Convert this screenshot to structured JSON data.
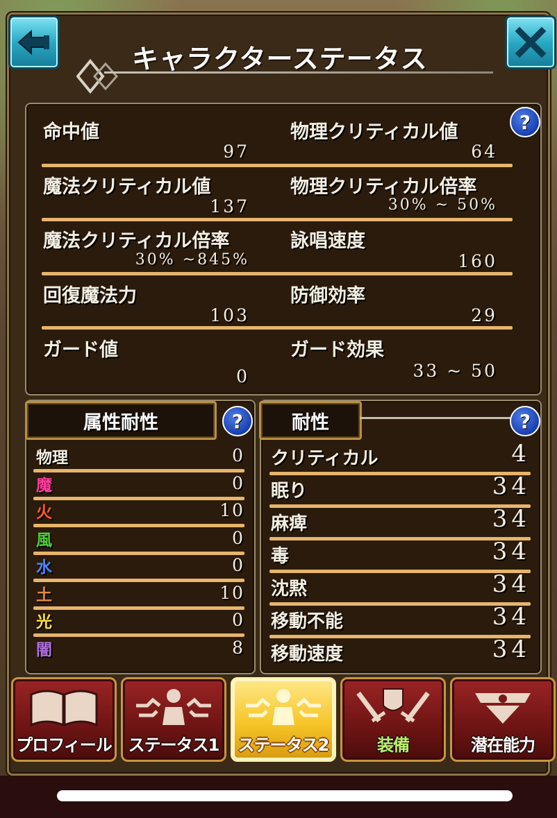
{
  "header": {
    "title": "キャラクターステータス"
  },
  "stats": {
    "rows": [
      {
        "left_label": "命中値",
        "left_value": "97",
        "right_label": "物理クリティカル値",
        "right_value": "64"
      },
      {
        "left_label": "魔法クリティカル値",
        "left_value": "137",
        "right_label": "物理クリティカル倍率",
        "right_value": "30% ~ 50%"
      },
      {
        "left_label": "魔法クリティカル倍率",
        "left_value": "30% ~845%",
        "right_label": "詠唱速度",
        "right_value": "160"
      },
      {
        "left_label": "回復魔法力",
        "left_value": "103",
        "right_label": "防御効率",
        "right_value": "29"
      },
      {
        "left_label": "ガード値",
        "left_value": "0",
        "right_label": "ガード効果",
        "right_value": "33 ~ 50"
      }
    ]
  },
  "element_resist": {
    "header": "属性耐性",
    "items": [
      {
        "label": "物理",
        "value": "0",
        "color": "#f4eee2"
      },
      {
        "label": "魔",
        "value": "0",
        "color": "#ff3fa0"
      },
      {
        "label": "火",
        "value": "10",
        "color": "#ff5a2a"
      },
      {
        "label": "風",
        "value": "0",
        "color": "#4fcf3a"
      },
      {
        "label": "水",
        "value": "0",
        "color": "#4a86ff"
      },
      {
        "label": "土",
        "value": "10",
        "color": "#e08a3a"
      },
      {
        "label": "光",
        "value": "0",
        "color": "#ffe23a"
      },
      {
        "label": "闇",
        "value": "8",
        "color": "#b070e0"
      }
    ]
  },
  "resist": {
    "header": "耐性",
    "items": [
      {
        "label": "クリティカル",
        "value": "4"
      },
      {
        "label": "眠り",
        "value": "34"
      },
      {
        "label": "麻痺",
        "value": "34"
      },
      {
        "label": "毒",
        "value": "34"
      },
      {
        "label": "沈黙",
        "value": "34"
      },
      {
        "label": "移動不能",
        "value": "34"
      },
      {
        "label": "移動速度",
        "value": "34"
      }
    ]
  },
  "help_glyph": "?",
  "tabs": [
    {
      "label": "プロフィール",
      "icon": "book-icon",
      "active": false
    },
    {
      "label": "ステータス1",
      "icon": "status-figure-icon",
      "active": false
    },
    {
      "label": "ステータス2",
      "icon": "status-figure-icon",
      "active": true
    },
    {
      "label": "装備",
      "icon": "swords-shield-icon",
      "active": false
    },
    {
      "label": "潜在能力",
      "icon": "crest-icon",
      "active": false
    }
  ],
  "colors": {
    "accent_line": "#e7b56b",
    "panel_bg": "#2a1b0c",
    "active_tab": "#f6c528",
    "inactive_tab": "#7a1818"
  }
}
